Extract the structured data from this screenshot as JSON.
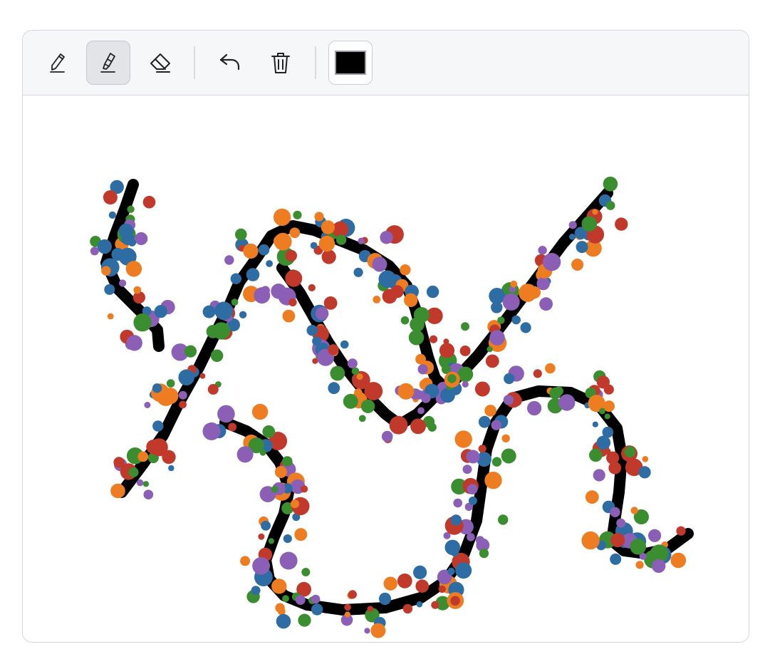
{
  "toolbar": {
    "tools": [
      {
        "name": "pen-tool",
        "icon": "pen-icon",
        "active": false
      },
      {
        "name": "marker-tool",
        "icon": "marker-icon",
        "active": true
      },
      {
        "name": "eraser-tool",
        "icon": "eraser-icon",
        "active": false
      },
      {
        "name": "undo-button",
        "icon": "undo-icon",
        "active": false
      },
      {
        "name": "clear-button",
        "icon": "trash-icon",
        "active": false
      }
    ],
    "current_color": "#000000"
  },
  "canvas": {
    "stroke_color": "#000000",
    "marker_palette": [
      "#2e6da4",
      "#ee7d22",
      "#3b8e2f",
      "#c0392b",
      "#8a5fb5"
    ]
  }
}
